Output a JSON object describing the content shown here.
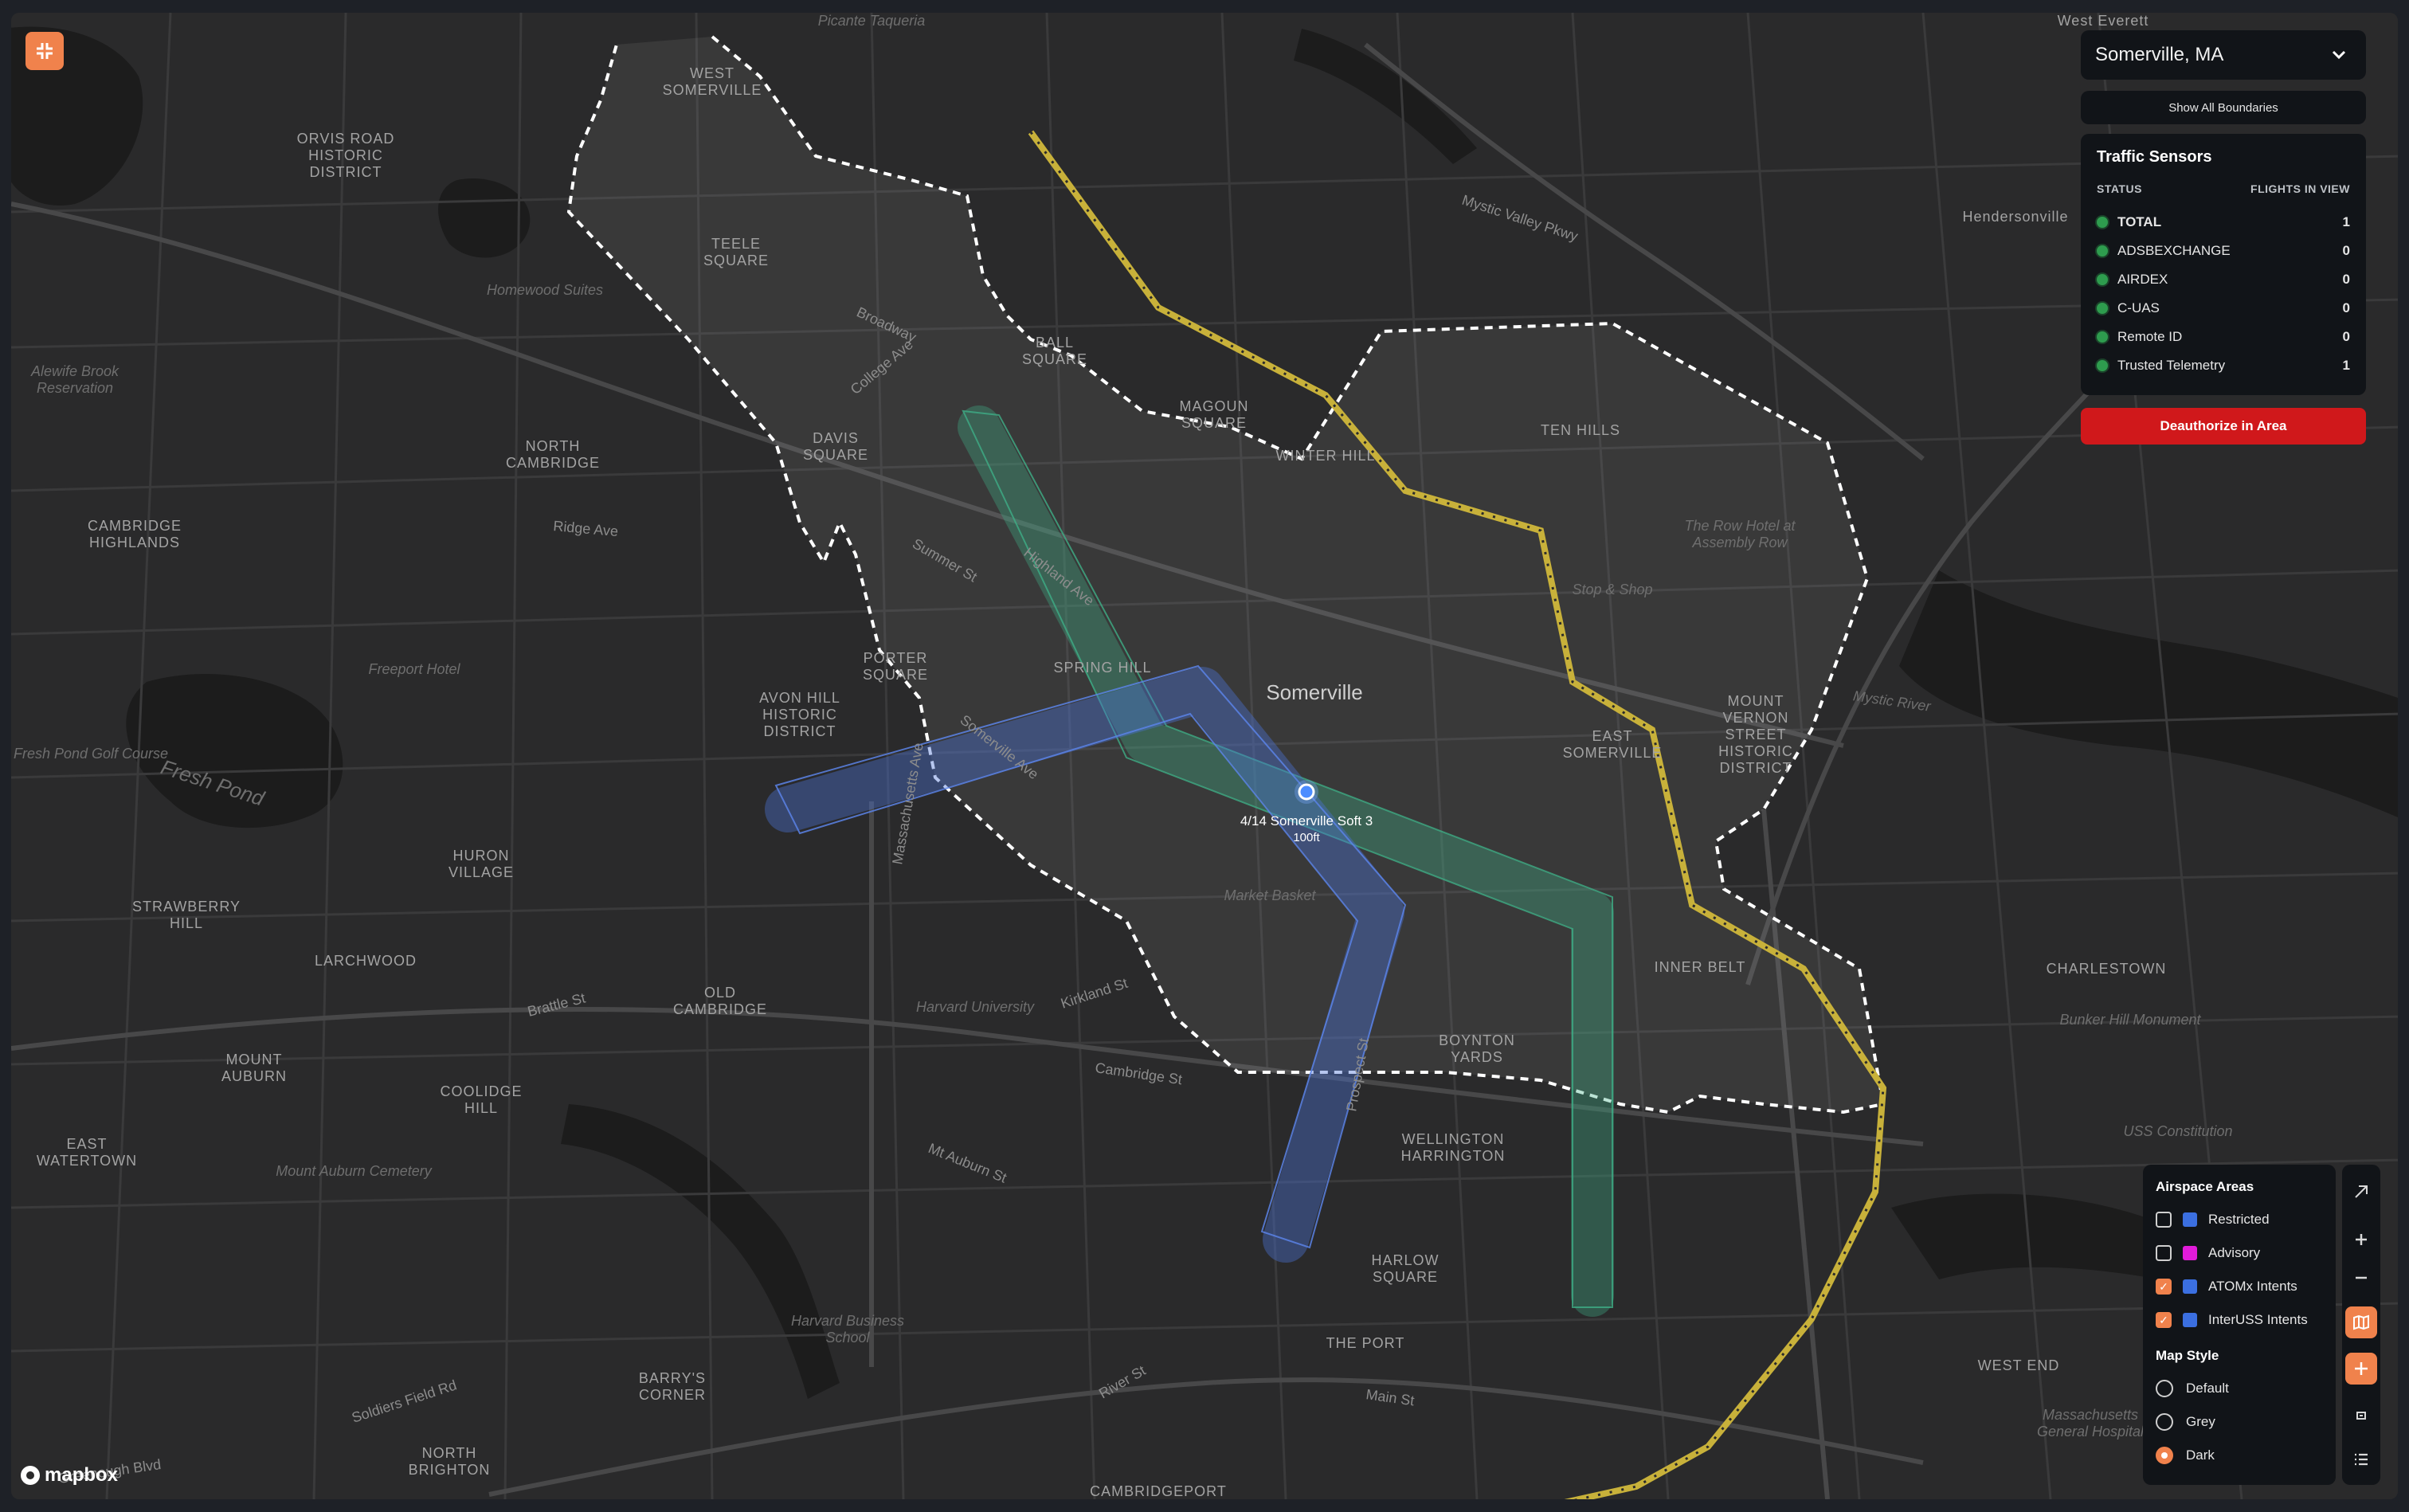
{
  "region_select": {
    "value": "Somerville, MA"
  },
  "boundaries_button": {
    "label": "Show All Boundaries"
  },
  "sensors": {
    "title": "Traffic Sensors",
    "col_status": "STATUS",
    "col_flights": "FLIGHTS IN VIEW",
    "rows": [
      {
        "name": "TOTAL",
        "count": "1",
        "status": "green"
      },
      {
        "name": "ADSBEXCHANGE",
        "count": "0",
        "status": "green"
      },
      {
        "name": "AIRDEX",
        "count": "0",
        "status": "green"
      },
      {
        "name": "C-UAS",
        "count": "0",
        "status": "green"
      },
      {
        "name": "Remote ID",
        "count": "0",
        "status": "green"
      },
      {
        "name": "Trusted Telemetry",
        "count": "1",
        "status": "green"
      }
    ]
  },
  "deauthorize_button": {
    "label": "Deauthorize in Area"
  },
  "airspace": {
    "heading": "Airspace Areas",
    "items": [
      {
        "label": "Restricted",
        "checked": false,
        "color": "#3b6fe0"
      },
      {
        "label": "Advisory",
        "checked": false,
        "color": "#e21bd9"
      },
      {
        "label": "ATOMx Intents",
        "checked": true,
        "color": "#3b6fe0"
      },
      {
        "label": "InterUSS Intents",
        "checked": true,
        "color": "#3b6fe0"
      }
    ]
  },
  "map_style": {
    "heading": "Map Style",
    "options": [
      {
        "label": "Default",
        "selected": false
      },
      {
        "label": "Grey",
        "selected": false
      },
      {
        "label": "Dark",
        "selected": true
      }
    ]
  },
  "drone": {
    "label": "4/14 Somerville Soft 3",
    "altitude": "100ft"
  },
  "city_label": "Somerville",
  "place_labels": {
    "west_somerville": "WEST\nSOMERVILLE",
    "teele_square": "TEELE\nSQUARE",
    "ball_square": "BALL\nSQUARE",
    "davis_square": "DAVIS\nSQUARE",
    "north_cambridge": "NORTH\nCAMBRIDGE",
    "cambridge_highlands": "CAMBRIDGE\nHIGHLANDS",
    "porter_square": "PORTER\nSQUARE",
    "spring_hill": "SPRING HILL",
    "avon_hill": "AVON HILL\nHISTORIC\nDISTRICT",
    "huron_village": "HURON\nVILLAGE",
    "strawberry_hill": "STRAWBERRY\nHILL",
    "larchwood": "LARCHWOOD",
    "old_cambridge": "OLD\nCAMBRIDGE",
    "mount_auburn": "MOUNT\nAUBURN",
    "coolidge_hill": "COOLIDGE\nHILL",
    "east_watertown": "EAST\nWATERTOWN",
    "magoun_square": "MAGOUN\nSQUARE",
    "winter_hill": "WINTER HILL",
    "ten_hills": "TEN HILLS",
    "east_somerville": "EAST\nSOMERVILLE",
    "inner_belt": "INNER BELT",
    "boynton_yards": "BOYNTON\nYARDS",
    "wellington_harrington": "WELLINGTON\nHARRINGTON",
    "harlow_square": "HARLOW\nSQUARE",
    "the_port": "THE PORT",
    "mount_vernon": "MOUNT\nVERNON\nSTREET\nHISTORIC\nDISTRICT",
    "charlestown": "CHARLESTOWN",
    "west_end": "WEST END",
    "barrys_corner": "BARRY'S\nCORNER",
    "north_brighton": "NORTH\nBRIGHTON",
    "orvis_road": "ORVIS ROAD\nHISTORIC\nDISTRICT",
    "hendersonville": "Hendersonville",
    "west_everett": "West Everett",
    "cambridgeport": "CAMBRIDGEPORT"
  },
  "water_labels": {
    "fresh_pond": "Fresh Pond",
    "mystic_river": "Mystic River",
    "alewife": "Alewife Brook\nReservation",
    "fresh_pond_golf": "Fresh Pond Golf Course",
    "freeport_hotel": "Freeport Hotel",
    "market_basket": "Market Basket",
    "harvard_univ": "Harvard University",
    "mount_auburn_cem": "Mount Auburn Cemetery",
    "harvard_business": "Harvard Business\nSchool",
    "stop_shop": "Stop & Shop",
    "row_hotel": "The Row Hotel at\nAssembly Row",
    "bunker_hill": "Bunker Hill Monument",
    "uss_constitution": "USS Constitution",
    "mass_general": "Massachusetts\nGeneral Hospital",
    "homewood": "Homewood Suites",
    "picante": "Picante Taqueria"
  },
  "street_labels": {
    "broadway": "Broadway",
    "highland": "Highland Ave",
    "summer": "Summer St",
    "somerville_ave": "Somerville Ave",
    "cambridge_st": "Cambridge St",
    "kirkland": "Kirkland St",
    "brattle": "Brattle St",
    "mt_auburn": "Mt Auburn St",
    "main_st": "Main St",
    "mystic_valley": "Mystic Valley Pkwy",
    "ridge": "Ridge Ave",
    "college": "College Ave",
    "mass_ave": "Massachusetts Ave",
    "prospect": "Prospect St",
    "river_st": "River St",
    "soldiers_field": "Soldiers Field Rd",
    "greenough": "Greenough Blvd"
  },
  "attribution": {
    "logo_text": "mapbox"
  },
  "colors": {
    "accent": "#f0824c",
    "danger": "#d0181b",
    "green_corridor": "#3fae86",
    "blue_corridor": "#4a72d6",
    "rail": "#c8b13a",
    "boundary": "#ffffff"
  }
}
